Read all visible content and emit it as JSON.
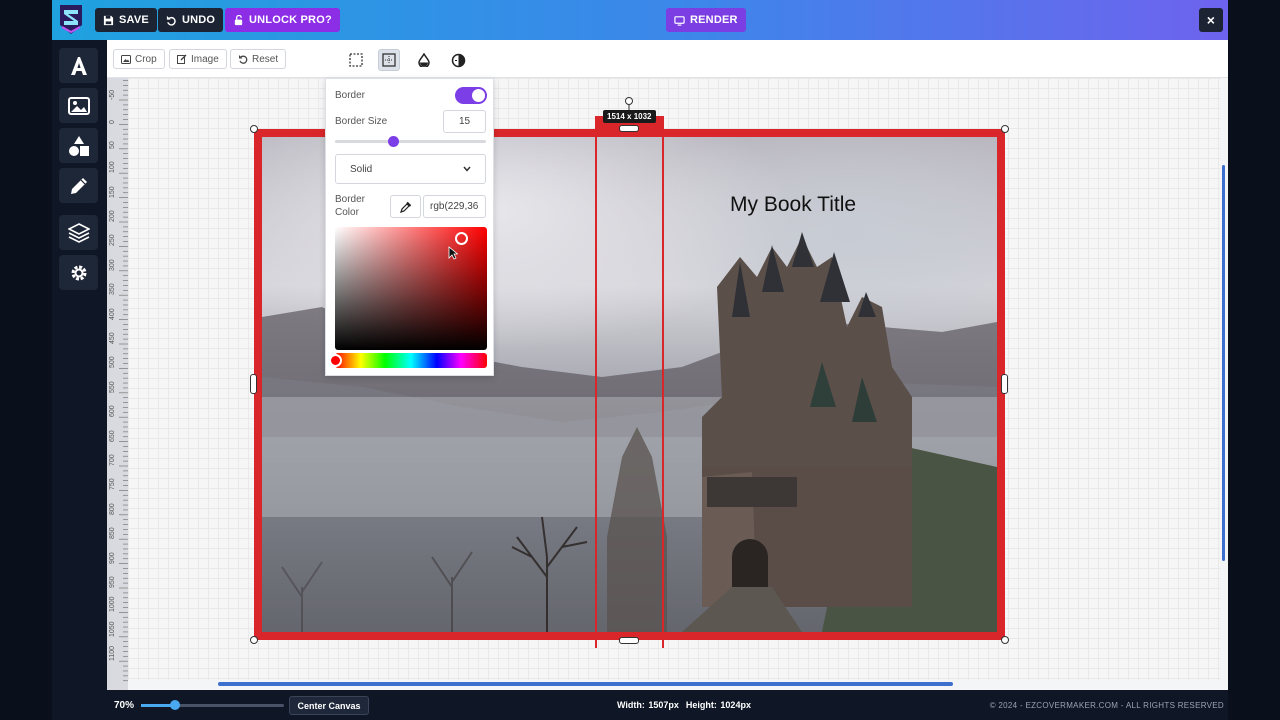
{
  "header": {
    "save_label": "SAVE",
    "undo_label": "UNDO",
    "unlock_label": "UNLOCK PRO?",
    "render_label": "RENDER",
    "close_label": "×"
  },
  "toolbar": {
    "crop_label": "Crop",
    "image_label": "Image",
    "reset_label": "Reset"
  },
  "ruler": {
    "labels": [
      "-50",
      "0",
      "50",
      "100",
      "150",
      "200",
      "250",
      "300",
      "350",
      "400",
      "450",
      "500",
      "550",
      "600",
      "650",
      "700",
      "750",
      "800",
      "850",
      "900",
      "950",
      "1000",
      "1050",
      "1100"
    ]
  },
  "canvas": {
    "size_badge": "1514 x 1032",
    "book_title": "My Book Title",
    "border_color": "#d8262b"
  },
  "border_panel": {
    "border_label": "Border",
    "border_enabled": true,
    "size_label": "Border Size",
    "size_value": "15",
    "style_value": "Solid",
    "color_label": "Border Color",
    "color_value": "rgb(229,36"
  },
  "footer": {
    "zoom": "70%",
    "center_label": "Center Canvas",
    "dimensions": "Width: 1507px  Height: 1024px",
    "copyright": "© 2024 - EZCOVERMAKER.COM - ALL RIGHTS RESERVED"
  },
  "colors": {
    "accent": "#7c3ee6",
    "topbar_start": "#1fa2df",
    "topbar_end": "#6e63ee"
  }
}
